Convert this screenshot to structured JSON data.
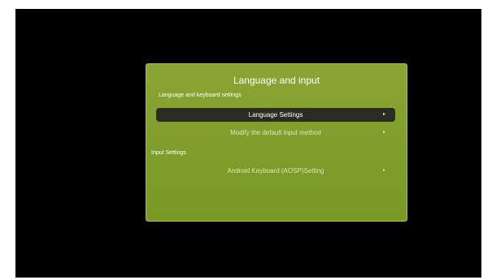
{
  "dialog": {
    "title": "Language and input",
    "section_keyboard": "Language and keyboard settings",
    "section_input": "Input Settings",
    "items": [
      {
        "label": "Language Settings",
        "chevron": "▸"
      },
      {
        "label": "Modify the default input method",
        "chevron": "▸"
      },
      {
        "label": "Android Keyboard (AOSP)Setting",
        "chevron": "▸"
      }
    ]
  },
  "colors": {
    "panel": "#83a12f",
    "selected_row": "#2b2d20",
    "background": "#000000"
  },
  "icons": {
    "chevron": "chevron-right-icon"
  }
}
